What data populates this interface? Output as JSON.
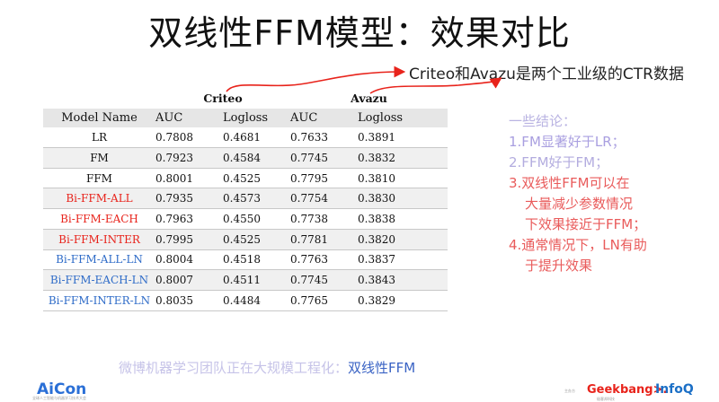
{
  "title": "双线性FFM模型：效果对比",
  "callout": "Criteo和Avazu是两个工业级的CTR数据",
  "table": {
    "groups": [
      "Criteo",
      "Avazu"
    ],
    "headers": [
      "Model Name",
      "AUC",
      "Logloss",
      "AUC",
      "Logloss"
    ],
    "rows": [
      [
        "LR",
        "0.7808",
        "0.4681",
        "0.7633",
        "0.3891"
      ],
      [
        "FM",
        "0.7923",
        "0.4584",
        "0.7745",
        "0.3832"
      ],
      [
        "FFM",
        "0.8001",
        "0.4525",
        "0.7795",
        "0.3810"
      ],
      [
        "Bi-FFM-ALL",
        "0.7935",
        "0.4573",
        "0.7754",
        "0.3830"
      ],
      [
        "Bi-FFM-EACH",
        "0.7963",
        "0.4550",
        "0.7738",
        "0.3838"
      ],
      [
        "Bi-FFM-INTER",
        "0.7995",
        "0.4525",
        "0.7781",
        "0.3820"
      ],
      [
        "Bi-FFM-ALL-LN",
        "0.8004",
        "0.4518",
        "0.7763",
        "0.3837"
      ],
      [
        "Bi-FFM-EACH-LN",
        "0.8007",
        "0.4511",
        "0.7745",
        "0.3843"
      ],
      [
        "Bi-FFM-INTER-LN",
        "0.8035",
        "0.4484",
        "0.7765",
        "0.3829"
      ]
    ]
  },
  "conclusions": {
    "heading": "一些结论：",
    "item1": "1.FM显著好于LR；",
    "item2": "2.FFM好于FM；",
    "item3_l1": "3.双线性FFM可以在",
    "item3_l2": "大量减少参数情况",
    "item3_l3": "下效果接近于FFM；",
    "item4_l1": "4.通常情况下，LN有助",
    "item4_l2": "于提升效果"
  },
  "footer": {
    "prefix": "微博机器学习团队正在大规模工程化：",
    "highlight": "双线性FFM"
  },
  "logos": {
    "left": "AiCon",
    "left_sub": "全球人工智能与机器学习技术大会",
    "right_sub": "主办方",
    "right1": "Geekbang>.",
    "right1_sub": "极客邦科技",
    "right2": "InfoQ"
  },
  "colors": {
    "red": "#e8231b",
    "blue": "#2f6cc8",
    "conclusion_heading": "#b9b3e2",
    "conclusion_item1": "#a99fe0",
    "conclusion_item2": "#b3acdf",
    "conclusion_red": "#e95b5b"
  }
}
